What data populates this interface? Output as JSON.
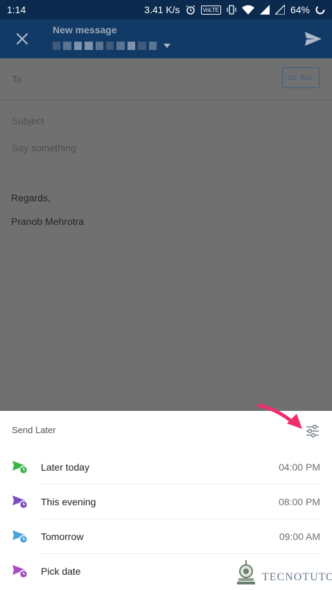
{
  "status_bar": {
    "time": "1:14",
    "speed": "3.41 K/s",
    "volte": "VoLTE",
    "battery": "64%",
    "icons": [
      "alarm-icon",
      "vibrate-icon",
      "wifi-icon",
      "signal-icon",
      "signal-icon-2",
      "battery-ring-icon"
    ]
  },
  "app_bar": {
    "title": "New message",
    "icons": [
      "close-icon",
      "chevron-down-icon",
      "send-icon"
    ],
    "bg": "#123a66"
  },
  "compose": {
    "to_label": "To",
    "cc_bcc": "Cc: Bcc:",
    "subject_placeholder": "Subject",
    "body_placeholder": "Say something",
    "signature_line1": "Regards,",
    "signature_line2": "Pranob Mehrotra"
  },
  "send_later": {
    "title": "Send Later",
    "filter_icon": "sliders-icon",
    "options": [
      {
        "label": "Later today",
        "time": "04:00 PM",
        "icon": "send-later-today-icon",
        "color": "#3ab54a"
      },
      {
        "label": "This evening",
        "time": "08:00 PM",
        "icon": "send-evening-icon",
        "color": "#7c4dbf"
      },
      {
        "label": "Tomorrow",
        "time": "09:00 AM",
        "icon": "send-tomorrow-icon",
        "color": "#4aa3df"
      },
      {
        "label": "Pick date",
        "time": "",
        "icon": "send-pick-date-icon",
        "color": "#a44dbf"
      }
    ]
  },
  "watermark": {
    "text": "TECNOTUTO",
    "icon": "tecnotuto-logo-icon"
  }
}
